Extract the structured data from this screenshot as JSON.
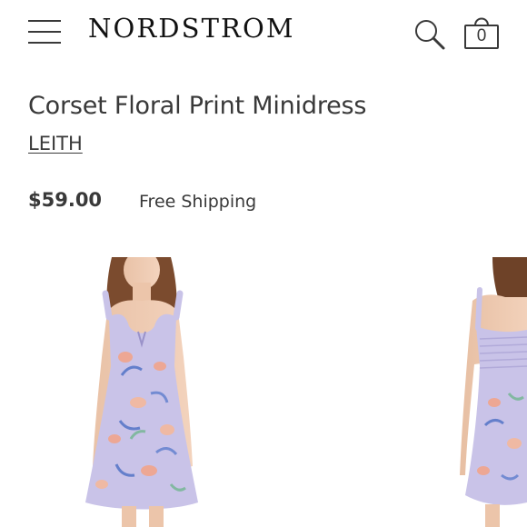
{
  "header": {
    "logo": "NORDSTROM",
    "bag_count": "0",
    "icons": {
      "menu": "menu-icon",
      "search": "search-icon",
      "bag": "shopping-bag-icon"
    }
  },
  "product": {
    "title": "Corset Floral Print Minidress",
    "brand": "LEITH",
    "price": "$59.00",
    "shipping": "Free Shipping"
  },
  "gallery": {
    "images": [
      {
        "view": "front",
        "dress_color": "#c9c3e8"
      },
      {
        "view": "back",
        "dress_color": "#c9c3e8"
      }
    ]
  },
  "colors": {
    "text": "#393939",
    "logo": "#111111",
    "dress": "#c9c3e8",
    "background": "#ffffff"
  }
}
